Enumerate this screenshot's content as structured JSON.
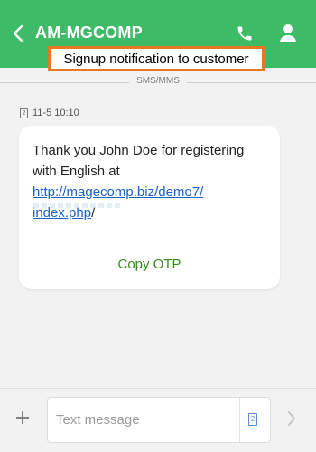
{
  "header": {
    "contact_name": "AM-MGCOMP",
    "icons": [
      "back-icon",
      "call-icon",
      "contact-icon"
    ],
    "background": "#3dbb67"
  },
  "caption": "Signup notification to customer",
  "divider_label": "SMS/MMS",
  "message": {
    "sim": "2",
    "timestamp": "11-5 10:10",
    "text_prefix": "Thank you John Doe for registering with English at ",
    "link_part1": "http://magecomp.biz/demo7/",
    "link_part2": "index.php",
    "text_suffix": "/",
    "action": "Copy OTP"
  },
  "composer": {
    "placeholder": "Text message",
    "sim": "2"
  },
  "colors": {
    "accent": "#3dbb67",
    "caption_border": "#e87722",
    "link": "#1a63c8",
    "action": "#3a8a1a"
  }
}
